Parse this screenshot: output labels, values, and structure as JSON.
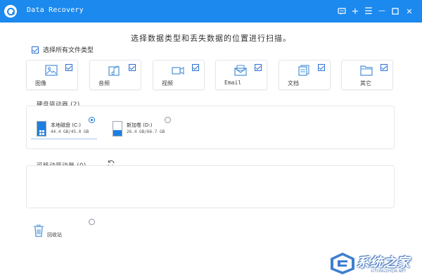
{
  "window": {
    "title": "Data Recovery",
    "accent_color": "#1b89ee",
    "buttons": [
      {
        "name": "feedback-icon"
      },
      {
        "name": "plus-icon",
        "glyph": "+"
      },
      {
        "name": "menu-icon",
        "glyph": "☰"
      },
      {
        "name": "minimize-icon",
        "glyph": "—"
      },
      {
        "name": "maximize-icon"
      },
      {
        "name": "close-icon",
        "glyph": "✕"
      }
    ]
  },
  "heading": "选择数据类型和丢失数据的位置进行扫描。",
  "select_all": {
    "label": "选择所有文件类型",
    "checked": true
  },
  "file_types": [
    {
      "label": "图像",
      "icon": "image-icon",
      "checked": true
    },
    {
      "label": "音频",
      "icon": "audio-icon",
      "checked": true
    },
    {
      "label": "视频",
      "icon": "video-icon",
      "checked": true
    },
    {
      "label": "Email",
      "icon": "email-icon",
      "checked": true
    },
    {
      "label": "文档",
      "icon": "document-icon",
      "checked": true
    },
    {
      "label": "其它",
      "icon": "folder-icon",
      "checked": true
    }
  ],
  "hard_drives": {
    "title": "硬盘驱动器 (2)",
    "drives": [
      {
        "name": "本地磁盘 (C:)",
        "size": "44.4 GB/45.0 GB",
        "used_fraction": 0.99,
        "selected": true,
        "os_drive": true
      },
      {
        "name": "新加卷 (D:)",
        "size": "26.4 GB/66.7 GB",
        "used_fraction": 0.4,
        "selected": false,
        "os_drive": false
      }
    ]
  },
  "removable": {
    "title": "可移动驱动器 (0)",
    "refresh_icon": "refresh-icon"
  },
  "recycle_bin": {
    "label": "回收站",
    "selected": false
  },
  "watermark": {
    "text": "系统之家",
    "url": "XITONGZHIJIA.NET"
  }
}
